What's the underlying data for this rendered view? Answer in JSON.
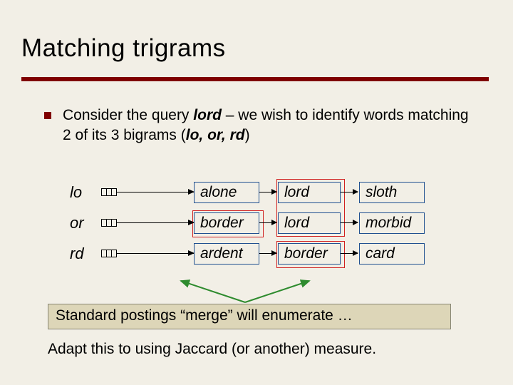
{
  "title": "Matching trigrams",
  "bullet": {
    "pre": "Consider the query ",
    "query_word": "lord",
    "mid": " – we wish to identify words matching 2 of its 3 bigrams (",
    "b1": "lo,",
    "b2": " or,",
    "b3": " rd",
    "post": ")"
  },
  "rows": [
    {
      "bigram": "lo",
      "cells": [
        "alone",
        "lord",
        "sloth"
      ]
    },
    {
      "bigram": "or",
      "cells": [
        "border",
        "lord",
        "morbid"
      ]
    },
    {
      "bigram": "rd",
      "cells": [
        "ardent",
        "border",
        "card"
      ]
    }
  ],
  "merge_line": "Standard postings “merge” will enumerate …",
  "adapt_line": "Adapt this to using Jaccard (or another) measure."
}
